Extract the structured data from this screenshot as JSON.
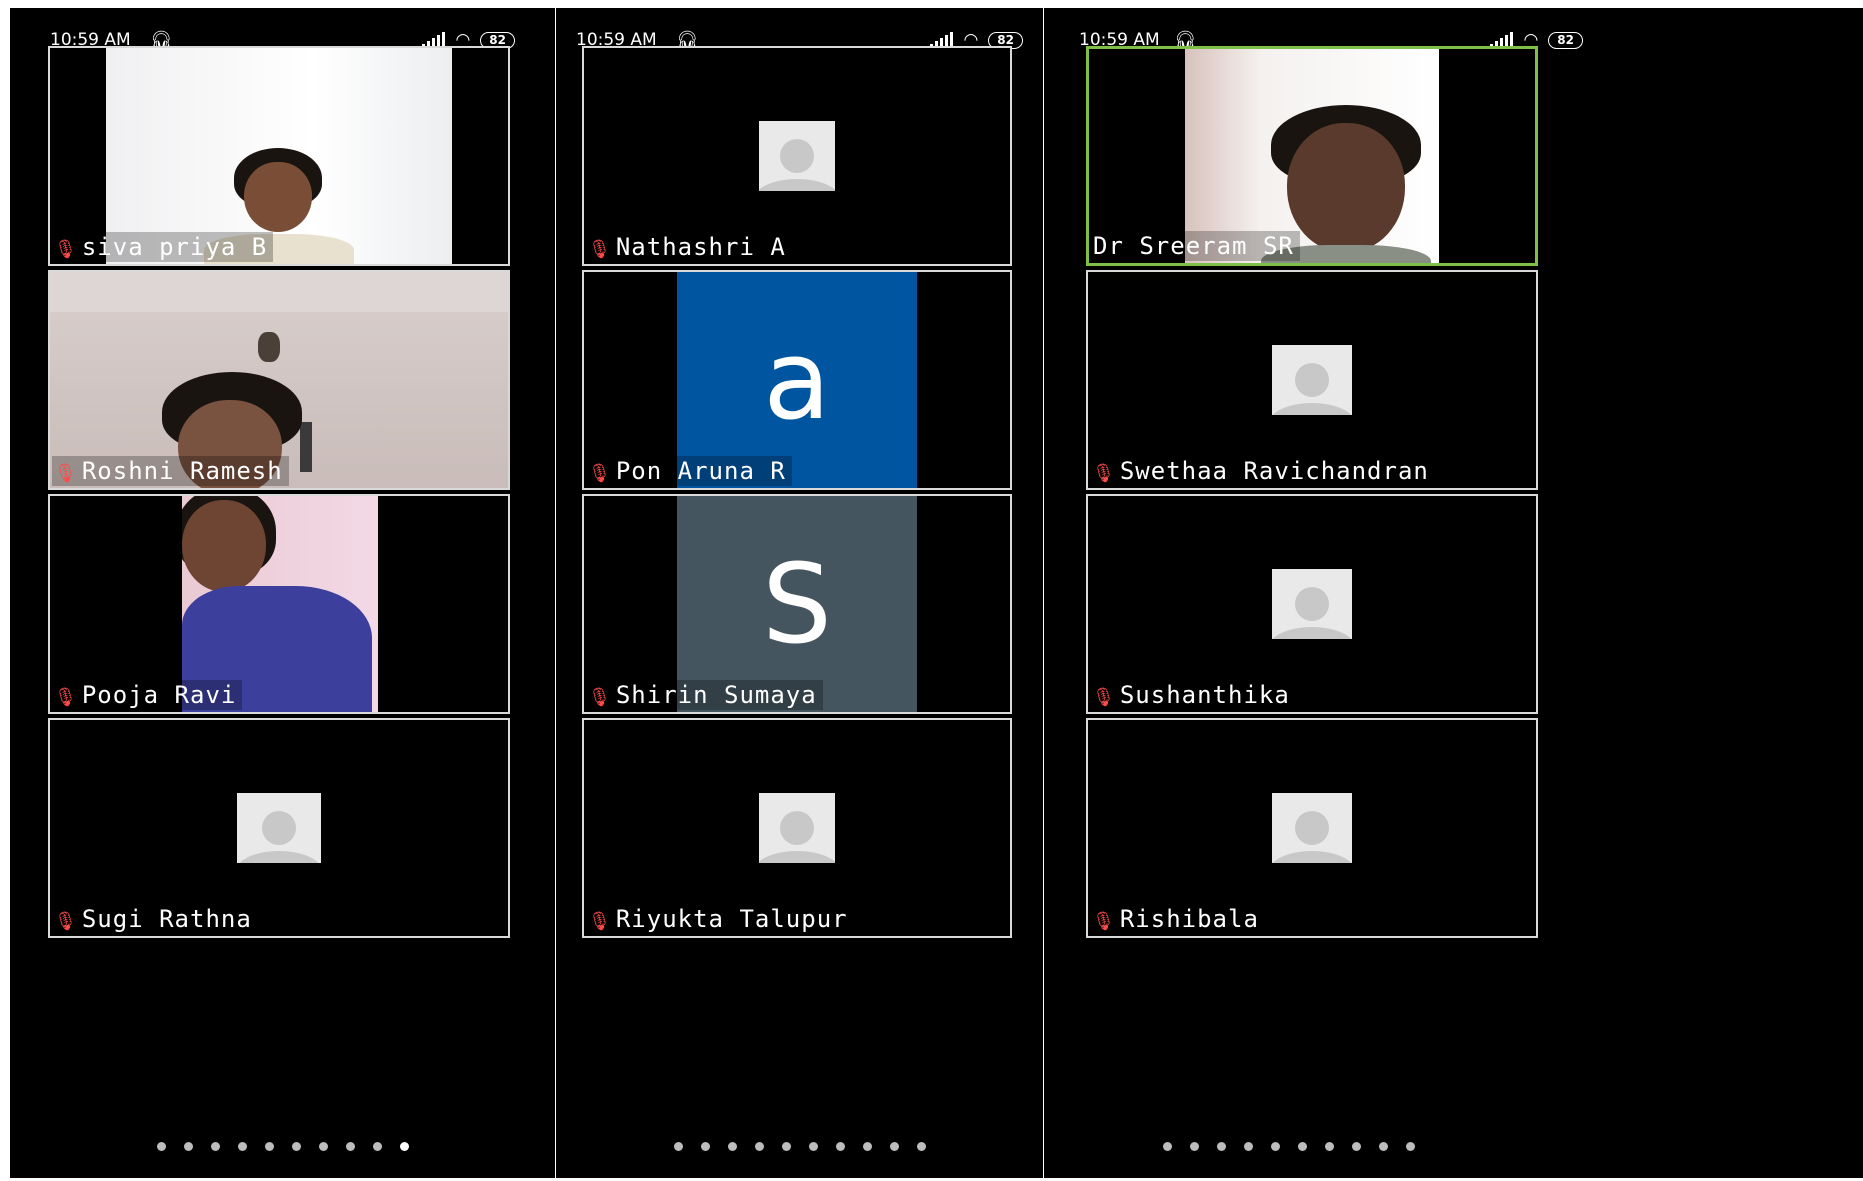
{
  "status": {
    "time": "10:59 AM",
    "battery": "82"
  },
  "screens": [
    {
      "tiles": [
        {
          "name": "siva priya B"
        },
        {
          "name": "Roshni Ramesh"
        },
        {
          "name": "Pooja Ravi"
        },
        {
          "name": "Sugi Rathna"
        }
      ],
      "page_dots": 10,
      "current_dot": 9
    },
    {
      "tiles": [
        {
          "name": "Nathashri A"
        },
        {
          "name": "Pon Aruna R",
          "letter": "a",
          "color": "#0055a0"
        },
        {
          "name": "Shirin Sumaya",
          "letter": "S",
          "color": "#44555f"
        },
        {
          "name": "Riyukta Talupur"
        }
      ],
      "page_dots": 10,
      "current_dot": -1
    },
    {
      "tiles": [
        {
          "name": "Dr Sreeram SR"
        },
        {
          "name": "Swethaa Ravichandran"
        },
        {
          "name": "Sushanthika"
        },
        {
          "name": "Rishibala"
        }
      ],
      "page_dots": 10,
      "current_dot": -1
    }
  ],
  "icons": {
    "mic": "mic-muted-icon",
    "headphone": "headphone-icon",
    "wifi": "wifi-icon",
    "signal": "signal-icon",
    "avatar": "default-avatar-icon"
  },
  "colors": {
    "active_speaker": "#7cc04a",
    "muted_mic": "#ff4a4a"
  }
}
